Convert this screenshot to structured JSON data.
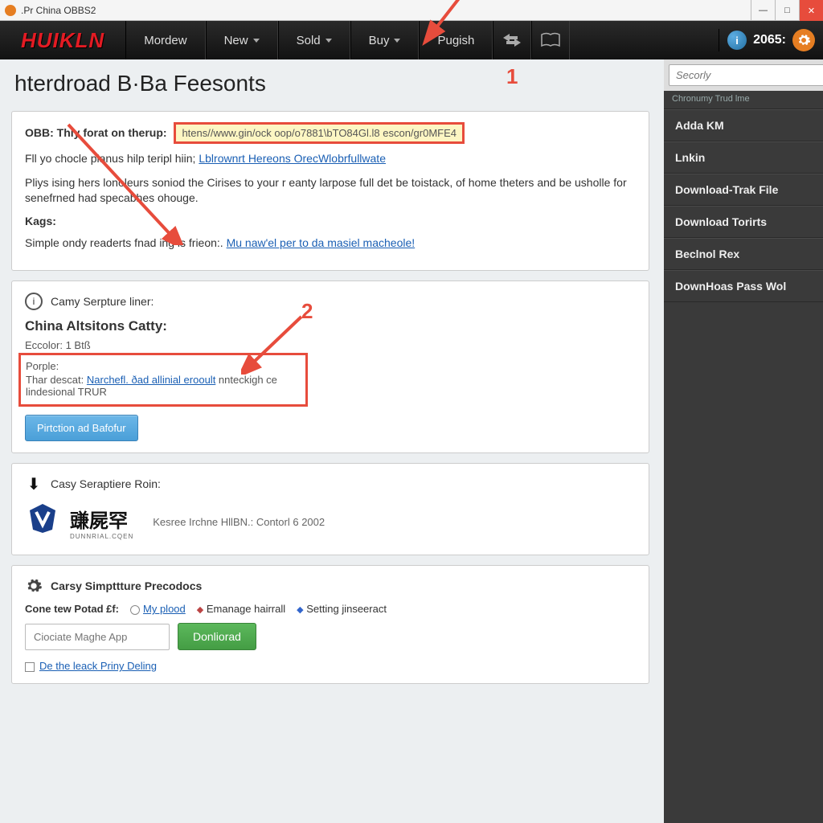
{
  "window": {
    "title": ".Pr China OBBS2"
  },
  "nav": {
    "logo": "HUIKLN",
    "items": [
      {
        "label": "Mordew",
        "caret": false
      },
      {
        "label": "New",
        "caret": true
      },
      {
        "label": "Sold",
        "caret": true
      },
      {
        "label": "Buy",
        "caret": true
      },
      {
        "label": "Pugish",
        "caret": false
      }
    ],
    "counter": "2065:"
  },
  "page": {
    "title": "hterdroad B·Bа Feesonts"
  },
  "annotations": {
    "num1": "1",
    "num2": "2"
  },
  "card1": {
    "obb_label": "OBB: Thiy forat on therup:",
    "url": "htens//www.gin/ock oop/o7881\\bTO84Gl.l8 escon/gr0MFE4",
    "line2a": "Fll yo chocle planus hilp teripl hiin; ",
    "line2link": "Lblrownrt Hereons OrecWlobrfullwate",
    "para": "Pliys ising hers lonoleurs soniod the Cirises to your r eanty larpose full det be toistack, of home theters and be usholle for senefrned had specabhes ohouge.",
    "kags_label": "Kags:",
    "kags_text": "Simple ondy readerts fnad ing is frieon:. ",
    "kags_link": "Mu naw'el per to da masiel macheole!"
  },
  "card2": {
    "header": "Camy Serpture liner:",
    "title": "China Altsitons Catty:",
    "excolor": "Eccolor: 1 Btß",
    "porple": "Porple:",
    "desc_label": "Thar descat: ",
    "desc_link": "Narchefl. ðad allinial erooult",
    "desc_tail": " nnteckigh ce lindesional TRUR",
    "button": "Pirtction ad Bafofur"
  },
  "card3": {
    "header": "Casy Seraptiere Roin:",
    "cjk": "豏屍罕",
    "cjk_sub": "DUNNRIAL.CQEN",
    "desc": "Kesree Irchne HllBN.: Contorl 6 2002"
  },
  "card4": {
    "header": "Carsy Simpttture Precodocs",
    "row_label": "Cone tew Potad £f:",
    "opt1": "My plood",
    "opt2": "Emanage hairrall",
    "opt3": "Setting jinseeract",
    "placeholder": "Ciociate Maghe App",
    "button": "Donliorad",
    "checkbox_link": "De the leack Priny Deling"
  },
  "sidebar": {
    "search_placeholder": "Secorly",
    "subhead": "Chronumy Trud lme",
    "items": [
      "Adda KM",
      "Lnkin",
      "Download-Trak File",
      "Download Torirts",
      "Beclnol Rex",
      "DownHoas Pass Wol"
    ]
  }
}
